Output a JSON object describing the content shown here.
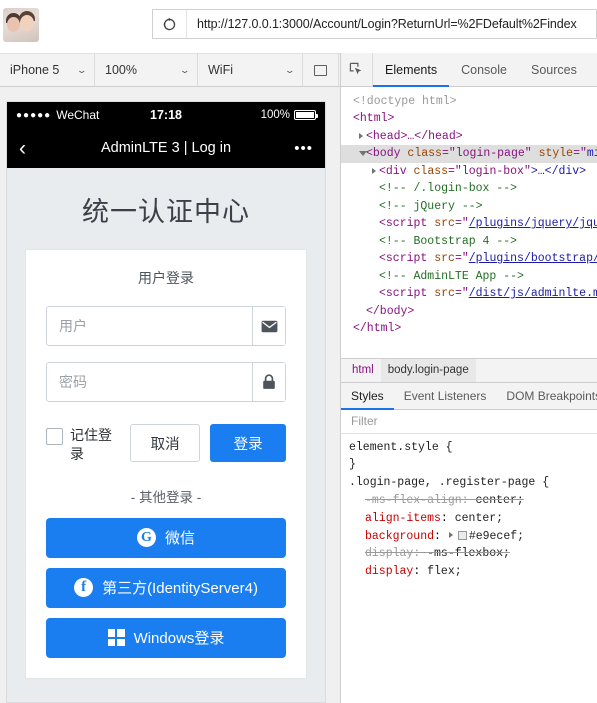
{
  "browser": {
    "url": "http://127.0.0.1:3000/Account/Login?ReturnUrl=%2FDefault%2Findex",
    "reload_icon": "reload-icon",
    "avatar_icon": "user-avatar-photo"
  },
  "device_toolbar": {
    "device": "iPhone 5",
    "zoom": "100%",
    "throttling": "WiFi",
    "rotate_icon": "rotate-device-icon"
  },
  "phone": {
    "status_bar": {
      "signal_dots": "●●●●●",
      "carrier": "WeChat",
      "time": "17:18",
      "battery_percent": "100%"
    },
    "nav_bar": {
      "back_icon": "chevron-left-icon",
      "title": "AdminLTE 3 | Log in",
      "more_icon": "more-options-icon"
    },
    "page": {
      "title": "统一认证中心",
      "card_subtitle": "用户登录",
      "username": {
        "value": "",
        "placeholder": "用户",
        "icon": "envelope-icon"
      },
      "password": {
        "value": "",
        "placeholder": "密码",
        "icon": "lock-icon"
      },
      "remember_label": "记住登录",
      "cancel_label": "取消",
      "login_label": "登录",
      "social_divider": "- 其他登录 -",
      "social_buttons": [
        {
          "icon": "google-icon",
          "glyph": "G",
          "label": "微信"
        },
        {
          "icon": "facebook-icon",
          "glyph": "f",
          "label": "第三方(IdentityServer4)"
        },
        {
          "icon": "windows-icon",
          "glyph": "",
          "label": "Windows登录"
        }
      ]
    }
  },
  "devtools": {
    "inspect_icon": "inspect-element-icon",
    "tabs": [
      {
        "label": "Elements",
        "active": true
      },
      {
        "label": "Console",
        "active": false
      },
      {
        "label": "Sources",
        "active": false
      }
    ],
    "dom_lines": [
      {
        "text": "<!doctype html>",
        "cls": "doct",
        "indent": 0,
        "tri": "none",
        "selected": false
      },
      {
        "text": "<html>",
        "cls": "tag",
        "indent": 0,
        "tri": "none",
        "selected": false
      },
      {
        "text": "<head>…</head>",
        "cls": "tag",
        "indent": 1,
        "tri": "closed",
        "selected": false
      },
      {
        "text": "<body class=\"login-page\" style=\"min",
        "cls": "tag",
        "indent": 1,
        "tri": "open",
        "selected": true
      },
      {
        "text": "<div class=\"login-box\">…</div>",
        "cls": "tag",
        "indent": 2,
        "tri": "closed",
        "selected": false
      },
      {
        "text": "<!-- /.login-box -->",
        "cls": "cmt",
        "indent": 2,
        "tri": "none",
        "selected": false
      },
      {
        "text": "<!-- jQuery -->",
        "cls": "cmt",
        "indent": 2,
        "tri": "none",
        "selected": false
      },
      {
        "text": "<script src=\"/plugins/jquery/jque",
        "cls": "tag",
        "indent": 2,
        "tri": "none",
        "selected": false
      },
      {
        "text": "<!-- Bootstrap 4 -->",
        "cls": "cmt",
        "indent": 2,
        "tri": "none",
        "selected": false
      },
      {
        "text": "<script src=\"/plugins/bootstrap/j",
        "cls": "tag",
        "indent": 2,
        "tri": "none",
        "selected": false
      },
      {
        "text": "<!-- AdminLTE App -->",
        "cls": "cmt",
        "indent": 2,
        "tri": "none",
        "selected": false
      },
      {
        "text": "<script src=\"/dist/js/adminlte.mi",
        "cls": "tag",
        "indent": 2,
        "tri": "none",
        "selected": false
      },
      {
        "text": "</body>",
        "cls": "tag",
        "indent": 1,
        "tri": "none",
        "selected": false
      },
      {
        "text": "</html>",
        "cls": "tag",
        "indent": 0,
        "tri": "none",
        "selected": false
      }
    ],
    "breadcrumb": [
      {
        "label": "html",
        "current": false
      },
      {
        "label": "body.login-page",
        "current": true
      }
    ],
    "style_tabs": [
      {
        "label": "Styles",
        "active": true
      },
      {
        "label": "Event Listeners",
        "active": false
      },
      {
        "label": "DOM Breakpoints",
        "active": false
      }
    ],
    "filter_placeholder": "Filter",
    "css_lines": [
      {
        "kind": "selector",
        "text": "element.style {",
        "struck": false
      },
      {
        "kind": "brace",
        "text": "}",
        "struck": false
      },
      {
        "kind": "selector",
        "text": ".login-page, .register-page {",
        "struck": false
      },
      {
        "kind": "decl",
        "prop": "-ms-flex-align",
        "value": "center;",
        "struck": true
      },
      {
        "kind": "decl",
        "prop": "align-items",
        "value": "center;",
        "struck": false
      },
      {
        "kind": "swatch",
        "prop": "background",
        "value": "#e9ecef;",
        "struck": false
      },
      {
        "kind": "decl",
        "prop": "display",
        "value": "-ms-flexbox;",
        "struck": true
      },
      {
        "kind": "decl",
        "prop": "display",
        "value": "flex;",
        "struck": false
      }
    ]
  }
}
